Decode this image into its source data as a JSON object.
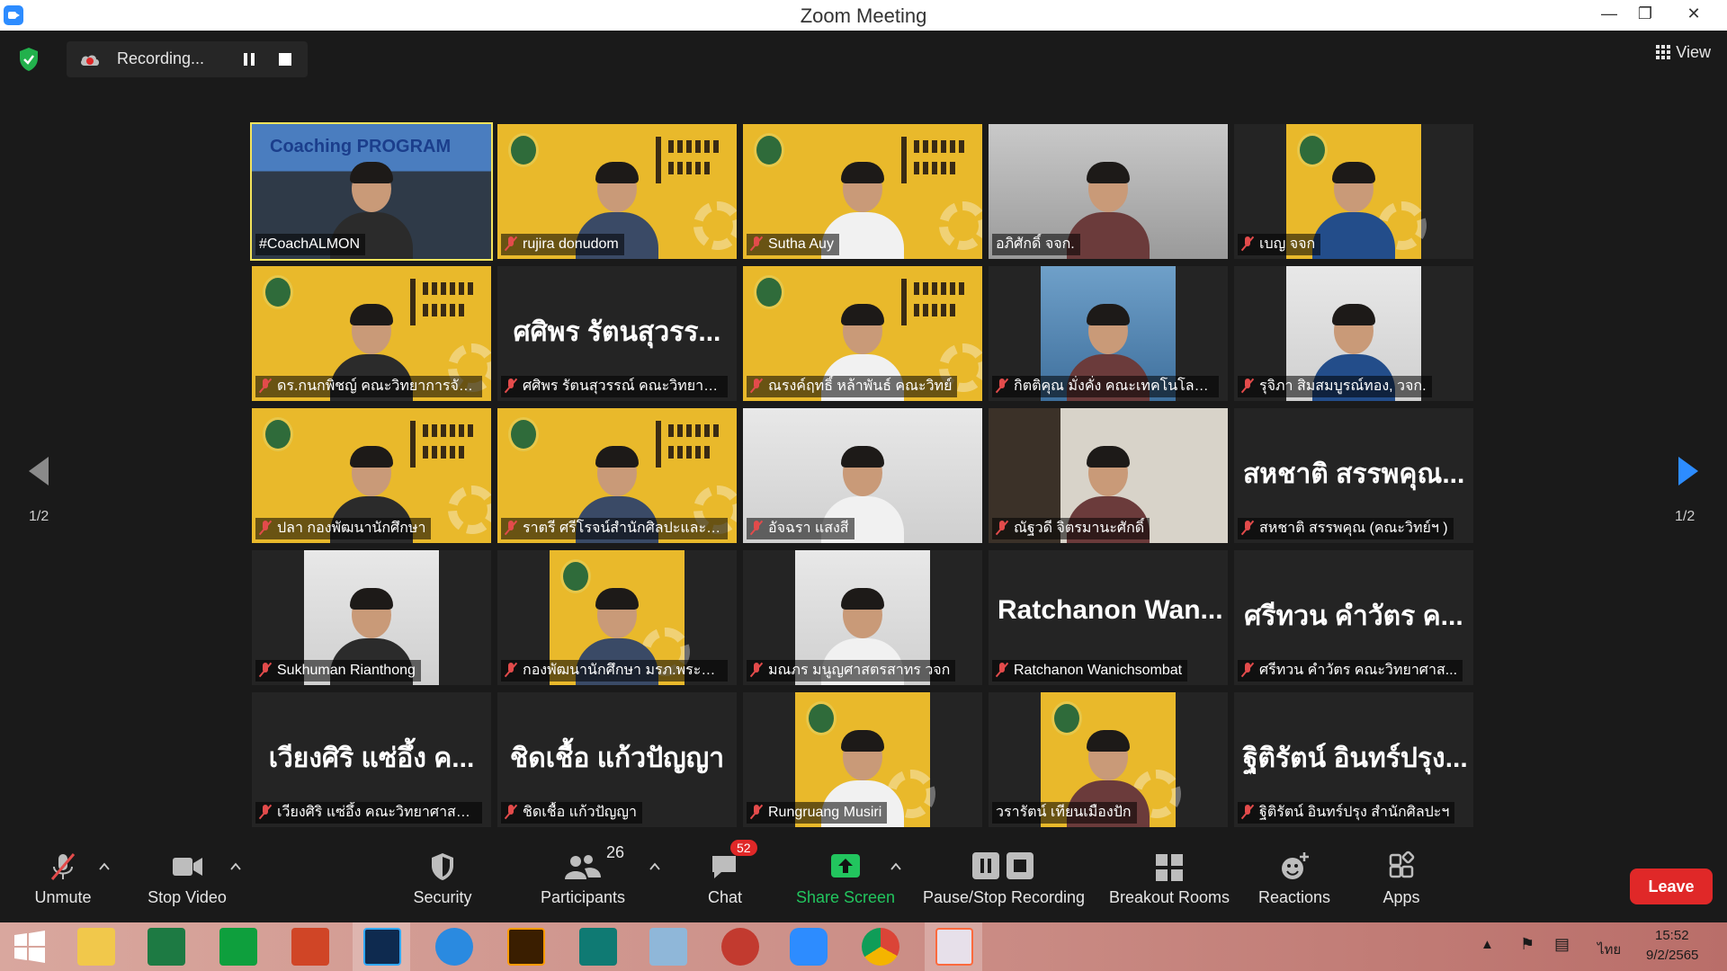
{
  "window": {
    "title": "Zoom Meeting"
  },
  "recording": {
    "label": "Recording..."
  },
  "view": {
    "label": "View"
  },
  "pagination": {
    "left": "1/2",
    "right": "1/2"
  },
  "tiles": [
    {
      "name": "#CoachALMON",
      "style": "class",
      "banner": "Coaching PROGRAM",
      "speaking": true,
      "muted": false
    },
    {
      "name": "rujira donudom",
      "style": "yellow",
      "muted": true
    },
    {
      "name": "Sutha Auy",
      "style": "yellow",
      "muted": true
    },
    {
      "name": "อภิศักดิ์ จจก.",
      "style": "room",
      "muted": false
    },
    {
      "name": "เบญ จจก",
      "style": "yellow-center",
      "muted": true
    },
    {
      "name": "ดร.กนกพิชญ์ คณะวิทยาการจัด...",
      "style": "yellow",
      "muted": true
    },
    {
      "name": "ศศิพร รัตนสุวรรณ์ คณะวิทยาศ...",
      "display": "ศศิพร รัตนสุวรร...",
      "style": "text",
      "muted": true
    },
    {
      "name": "ณรงค์ฤทธิ์ หล้าพันธ์ คณะวิทย์",
      "style": "yellow",
      "muted": true
    },
    {
      "name": "กิตติคุณ มั่งคั่ง คณะเทคโนโลยีอุ...",
      "style": "portrait-center",
      "muted": true
    },
    {
      "name": "รุจิภา สิมสมบูรณ์ทอง, วจก.",
      "style": "office-center",
      "muted": true
    },
    {
      "name": "ปลา กองพัฒนานักศึกษา",
      "style": "yellow",
      "muted": true
    },
    {
      "name": "ราตรี ศรีโรจน์สำนักศิลปะและวั...",
      "style": "yellow",
      "muted": true
    },
    {
      "name": "อัจฉรา แสงสี",
      "style": "office",
      "muted": true
    },
    {
      "name": "ณัฐวดี จิตรมานะศักดิ์",
      "style": "shelf",
      "muted": true
    },
    {
      "name": "สหชาติ สรรพคุณ (คณะวิทย์ฯ )",
      "display": "สหชาติ สรรพคุณ...",
      "style": "text",
      "muted": true
    },
    {
      "name": "Sukhuman Rianthong",
      "style": "office-center",
      "muted": true
    },
    {
      "name": "กองพัฒนานักศึกษา มรภ.พระนคร",
      "style": "yellow-center",
      "muted": true
    },
    {
      "name": "มณภร มนูญศาสตรสาทร วจก",
      "style": "office-center",
      "muted": true
    },
    {
      "name": "Ratchanon Wanichsombat",
      "display": "Ratchanon Wan...",
      "style": "text",
      "muted": true
    },
    {
      "name": "ศรีทวน คำวัตร คณะวิทยาศาส...",
      "display": "ศรีทวน คำวัตร ค...",
      "style": "text",
      "muted": true
    },
    {
      "name": "เวียงศิริ แซ่อึ้ง คณะวิทยาศาสต...",
      "display": "เวียงศิริ แซ่อึ้ง ค...",
      "style": "text",
      "muted": true
    },
    {
      "name": "ชิดเชื้อ แก้วปัญญา",
      "display": "ชิดเชื้อ แก้วปัญญา",
      "style": "text",
      "muted": true
    },
    {
      "name": "Rungruang Musiri",
      "style": "yellow-center",
      "muted": true
    },
    {
      "name": "วรารัตน์ เทียนเมืองปัก",
      "style": "yellow-center",
      "muted": false
    },
    {
      "name": "ฐิติรัตน์ อินทร์ปรุง สำนักศิลปะฯ",
      "display": "ฐิติรัตน์ อินทร์ปรุง...",
      "style": "text",
      "muted": true
    }
  ],
  "toolbar": {
    "unmute": "Unmute",
    "stop_video": "Stop Video",
    "security": "Security",
    "participants": "Participants",
    "participants_count": "26",
    "chat": "Chat",
    "chat_badge": "52",
    "share_screen": "Share Screen",
    "pause_stop_recording": "Pause/Stop Recording",
    "breakout_rooms": "Breakout Rooms",
    "reactions": "Reactions",
    "apps": "Apps",
    "leave": "Leave"
  },
  "taskbar": {
    "apps": [
      "windows-start",
      "file-explorer",
      "excel",
      "store",
      "powerpoint",
      "photoshop",
      "internet-explorer",
      "illustrator",
      "publisher",
      "notes",
      "photoscape",
      "zoom",
      "chrome",
      "photos"
    ],
    "language": "ไทย",
    "time": "15:52",
    "date": "9/2/2565"
  },
  "colors": {
    "accent_blue": "#2d8cff",
    "leave_red": "#e02828",
    "share_green": "#22c55e",
    "speaker_border": "#f3e35c",
    "brand_yellow": "#e9b92b"
  }
}
